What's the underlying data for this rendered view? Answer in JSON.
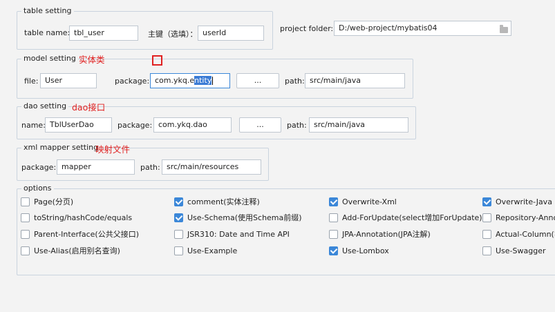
{
  "table_setting": {
    "legend": "table setting",
    "table_name_label": "table  name:",
    "table_name_value": "tbl_user",
    "pk_label": "主键（选填）：",
    "pk_value": "userId"
  },
  "project_folder": {
    "label": "project folder:",
    "value": "D:/web-project/mybatis04",
    "icon": "folder-icon"
  },
  "model_setting": {
    "legend": "model setting",
    "annotation": "实体类",
    "file_label": "file:",
    "file_value": "User",
    "package_label": "package:",
    "package_value_before": "com.ykq.e",
    "package_value_selected": "ntity",
    "browse_label": "...",
    "path_label": "path:",
    "path_value": "src/main/java"
  },
  "dao_setting": {
    "legend": "dao setting",
    "annotation": "dao接口",
    "name_label": "name:",
    "name_value": "TblUserDao",
    "package_label": "package:",
    "package_value": "com.ykq.dao",
    "browse_label": "...",
    "path_label": "path:",
    "path_value": "src/main/java"
  },
  "xml_setting": {
    "legend": "xml mapper setting",
    "annotation": "映射文件",
    "package_label": "package:",
    "package_value": "mapper",
    "path_label": "path:",
    "path_value": "src/main/resources"
  },
  "options": {
    "legend": "options",
    "items": [
      {
        "label": "Page(分页)",
        "checked": false
      },
      {
        "label": "comment(实体注释)",
        "checked": true
      },
      {
        "label": "Overwrite-Xml",
        "checked": true
      },
      {
        "label": "Overwrite-Java",
        "checked": true
      },
      {
        "label": "toString/hashCode/equals",
        "checked": false
      },
      {
        "label": "Use-Schema(使用Schema前缀)",
        "checked": true
      },
      {
        "label": "Add-ForUpdate(select增加ForUpdate)",
        "checked": false
      },
      {
        "label": "Repository-Anno",
        "checked": false
      },
      {
        "label": "Parent-Interface(公共父接口)",
        "checked": false
      },
      {
        "label": "JSR310: Date and Time API",
        "checked": false
      },
      {
        "label": "JPA-Annotation(JPA注解)",
        "checked": false
      },
      {
        "label": "Actual-Column(实",
        "checked": false
      },
      {
        "label": "Use-Alias(启用别名查询)",
        "checked": false
      },
      {
        "label": "Use-Example",
        "checked": false
      },
      {
        "label": "Use-Lombox",
        "checked": true
      },
      {
        "label": "Use-Swagger",
        "checked": false
      }
    ]
  }
}
